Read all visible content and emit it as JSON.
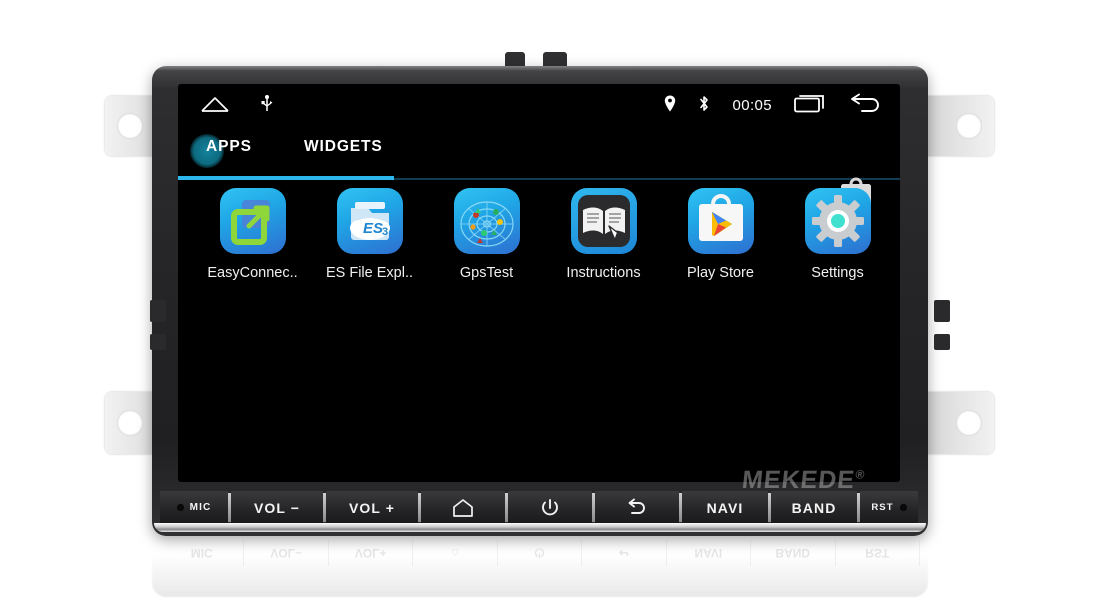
{
  "device": {
    "brand_watermark": "MEKEDE",
    "brand_reg": "®"
  },
  "statusbar": {
    "home_icon": "home-icon",
    "usb_icon": "usb-icon",
    "location_icon": "location-pin-icon",
    "bluetooth_icon": "bluetooth-icon",
    "time": "00:05",
    "recents_icon": "recent-apps-icon",
    "back_icon": "back-arrow-icon"
  },
  "tabs": [
    {
      "label": "APPS",
      "selected": true
    },
    {
      "label": "WIDGETS",
      "selected": false
    }
  ],
  "shortcut": {
    "name": "play-store-shortcut",
    "label": "Play Store"
  },
  "apps": [
    {
      "label": "EasyConnec..",
      "icon": "easyconnect-icon"
    },
    {
      "label": "ES File Expl..",
      "icon": "es-file-explorer-icon"
    },
    {
      "label": "GpsTest",
      "icon": "gpstest-icon"
    },
    {
      "label": "Instructions",
      "icon": "instructions-icon"
    },
    {
      "label": "Play Store",
      "icon": "play-store-icon"
    },
    {
      "label": "Settings",
      "icon": "settings-gear-icon"
    }
  ],
  "buttons": [
    {
      "label": "MIC",
      "type": "mic"
    },
    {
      "label": "VOL −",
      "type": "vol-down"
    },
    {
      "label": "VOL +",
      "type": "vol-up"
    },
    {
      "label": "",
      "type": "home"
    },
    {
      "label": "",
      "type": "power"
    },
    {
      "label": "",
      "type": "back"
    },
    {
      "label": "NAVI",
      "type": "navi"
    },
    {
      "label": "BAND",
      "type": "band"
    },
    {
      "label": "RST",
      "type": "reset"
    }
  ],
  "colors": {
    "accent_blue": "#2db7ef",
    "tab_glow": "#13839c",
    "icon_blue": "#1fa6e6",
    "screen_bg": "#000000",
    "bezel": "#262628"
  }
}
